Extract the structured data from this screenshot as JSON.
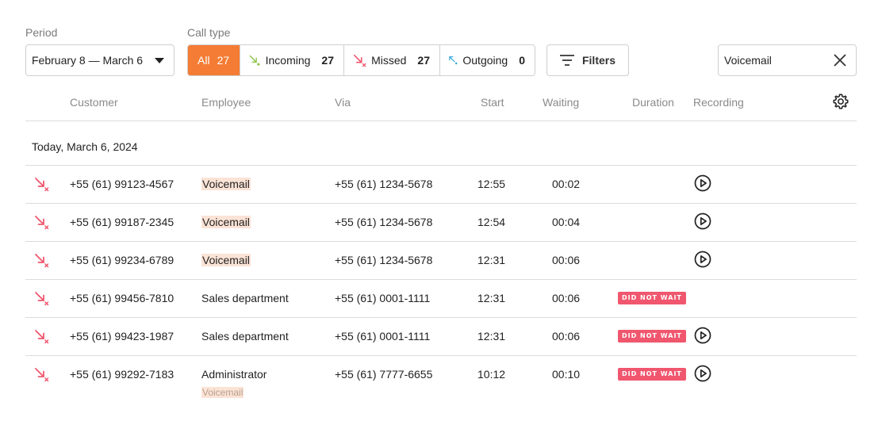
{
  "filters_bar": {
    "period_label": "Period",
    "period_value": "February 8 — March 6",
    "call_type_label": "Call type",
    "call_types": [
      {
        "label": "All",
        "count": "27"
      },
      {
        "label": "Incoming",
        "count": "27"
      },
      {
        "label": "Missed",
        "count": "27"
      },
      {
        "label": "Outgoing",
        "count": "0"
      }
    ],
    "filters_label": "Filters",
    "search_value": "Voicemail"
  },
  "table": {
    "columns": [
      "Customer",
      "Employee",
      "Via",
      "Start",
      "Waiting",
      "Duration",
      "Recording"
    ],
    "group_label": "Today, March 6, 2024",
    "badge_text": "DID NOT WAIT",
    "rows": [
      {
        "customer": "+55 (61) 99123-4567",
        "employee": "Voicemail",
        "via": "+55 (61) 1234-5678",
        "start": "12:55",
        "waiting": "00:02"
      },
      {
        "customer": "+55 (61) 99187-2345",
        "employee": "Voicemail",
        "via": "+55 (61) 1234-5678",
        "start": "12:54",
        "waiting": "00:04"
      },
      {
        "customer": "+55 (61) 99234-6789",
        "employee": "Voicemail",
        "via": "+55 (61) 1234-5678",
        "start": "12:31",
        "waiting": "00:06"
      },
      {
        "customer": "+55 (61) 99456-7810",
        "employee": "Sales department",
        "via": "+55 (61) 0001-1111",
        "start": "12:31",
        "waiting": "00:06"
      },
      {
        "customer": "+55 (61) 99423-1987",
        "employee": "Sales department",
        "via": "+55 (61) 0001-1111",
        "start": "12:31",
        "waiting": "00:06"
      },
      {
        "customer": "+55 (61) 99292-7183",
        "employee": "Administrator",
        "employee_sub": "Voicemail",
        "via": "+55 (61) 7777-6655",
        "start": "10:12",
        "waiting": "00:10"
      }
    ]
  },
  "colors": {
    "accent": "#f47c34",
    "missed": "#f0576e",
    "incoming": "#8bc34a",
    "outgoing": "#29a3d8",
    "highlight": "#fbe3d6"
  },
  "icons": [
    "chevron-down-icon",
    "incoming-call-icon",
    "missed-call-icon",
    "outgoing-call-icon",
    "filter-icon",
    "close-icon",
    "gear-icon",
    "play-icon"
  ]
}
